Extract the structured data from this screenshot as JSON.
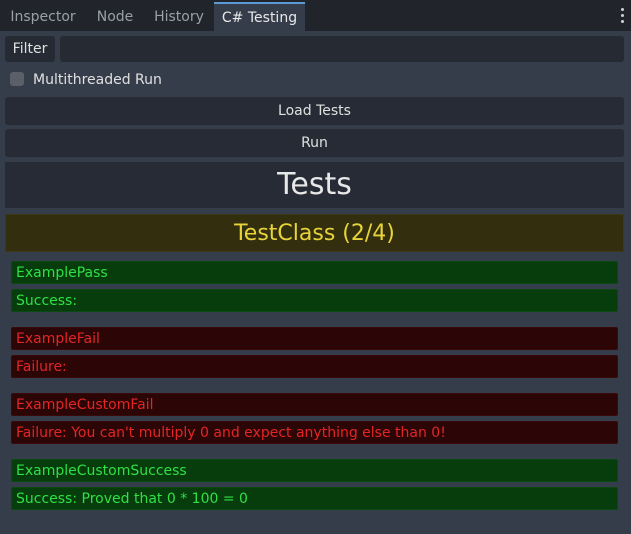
{
  "tabs": [
    {
      "label": "Inspector"
    },
    {
      "label": "Node"
    },
    {
      "label": "History"
    },
    {
      "label": "C# Testing"
    }
  ],
  "filter": {
    "button_label": "Filter",
    "value": ""
  },
  "options": {
    "multithreaded_label": "Multithreaded Run",
    "multithreaded_checked": false
  },
  "actions": {
    "load_label": "Load Tests",
    "run_label": "Run"
  },
  "tests_title": "Tests",
  "test_class": {
    "title": "TestClass (2/4)"
  },
  "results": [
    {
      "name": "ExamplePass",
      "message": "Success:",
      "status": "pass"
    },
    {
      "name": "ExampleFail",
      "message": "Failure:",
      "status": "fail"
    },
    {
      "name": "ExampleCustomFail",
      "message": "Failure: You can't multiply 0 and expect anything else than 0!",
      "status": "fail"
    },
    {
      "name": "ExampleCustomSuccess",
      "message": "Success: Proved that 0 * 100 = 0",
      "status": "pass"
    }
  ],
  "colors": {
    "pass_text": "#2fe046",
    "pass_bg": "#073d0c",
    "fail_text": "#e22626",
    "fail_bg": "#2c0506",
    "class_text": "#e8d43a",
    "class_bg": "#332f0e",
    "tab_accent": "#5b9bd5"
  }
}
